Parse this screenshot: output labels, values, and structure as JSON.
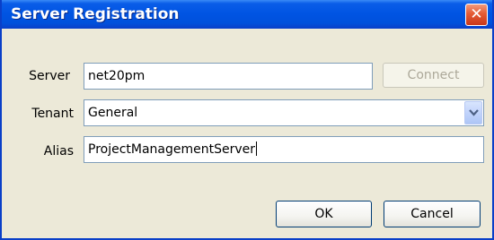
{
  "window": {
    "title": "Server Registration",
    "close_glyph": "✕"
  },
  "form": {
    "server_label": "Server",
    "server_value": "net20pm",
    "connect_label": "Connect",
    "tenant_label": "Tenant",
    "tenant_value": "General",
    "alias_label": "Alias",
    "alias_value": "ProjectManagementServer"
  },
  "buttons": {
    "ok_label": "OK",
    "cancel_label": "Cancel"
  },
  "icons": {
    "close": "close-icon",
    "dropdown": "chevron-down-icon"
  },
  "colors": {
    "titlebar": "#0054e3",
    "dialog_background": "#ece9d8",
    "field_border": "#7f9db9",
    "close_button": "#e45b34"
  }
}
